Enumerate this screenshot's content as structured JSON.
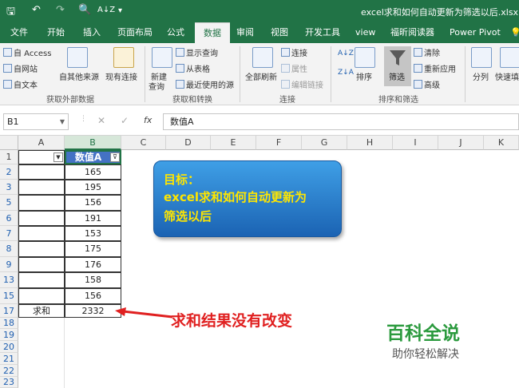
{
  "window": {
    "title": "excel求和如何自动更新为筛选以后.xlsx  -  Ex"
  },
  "qat": {
    "save": "🖫",
    "undo": "↶",
    "redo": "↷",
    "preview": "🔍",
    "sort": "A↓Z",
    "more": "▾"
  },
  "tabs": [
    "文件",
    "开始",
    "插入",
    "页面布局",
    "公式",
    "数据",
    "审阅",
    "视图",
    "开发工具",
    "view",
    "福昕阅读器",
    "Power Pivot",
    "💡"
  ],
  "active_tab": "数据",
  "ribbon": {
    "get_external": {
      "access": "自 Access",
      "web": "自网站",
      "text": "自文本",
      "other": "自其他来源",
      "existing": "现有连接",
      "label": "获取外部数据"
    },
    "get_transform": {
      "new_query": "新建",
      "new_query2": "查询",
      "show_queries": "显示查询",
      "from_table": "从表格",
      "recent": "最近使用的源",
      "label": "获取和转换"
    },
    "connections": {
      "refresh_all": "全部刷新",
      "connections": "连接",
      "properties": "属性",
      "edit_links": "编辑链接",
      "label": "连接"
    },
    "sort_filter": {
      "sort": "排序",
      "filter": "筛选",
      "clear": "清除",
      "reapply": "重新应用",
      "advanced": "高级",
      "label": "排序和筛选",
      "az": "A↓Z",
      "za": "Z↓A"
    },
    "tools": {
      "split": "分列",
      "quick_fill": "快速填"
    }
  },
  "formula_bar": {
    "name_box": "B1",
    "cancel": "✕",
    "enter": "✓",
    "fx": "fx",
    "content": "数值A"
  },
  "columns": [
    "A",
    "B",
    "C",
    "D",
    "E",
    "F",
    "G",
    "H",
    "I",
    "J",
    "K"
  ],
  "rows": [
    "1",
    "2",
    "3",
    "5",
    "6",
    "7",
    "8",
    "9",
    "13",
    "15",
    "17",
    "18",
    "19",
    "20",
    "21",
    "22",
    "23"
  ],
  "table": {
    "header_b": "数值A",
    "values": [
      "165",
      "195",
      "156",
      "191",
      "153",
      "175",
      "176",
      "158",
      "156"
    ],
    "sum_label": "求和",
    "sum_value": "2332"
  },
  "callout": {
    "line1": "目标：",
    "line2": "excel求和如何自动更新为",
    "line3": "筛选以后"
  },
  "annotation": "求和结果没有改变",
  "watermark": {
    "logo": "百科全说",
    "slogan": "助你轻松解决"
  },
  "colors": {
    "excel_green": "#217346",
    "header_blue": "#4472c4",
    "callout_text": "#ffe600",
    "note_red": "#e02020"
  }
}
